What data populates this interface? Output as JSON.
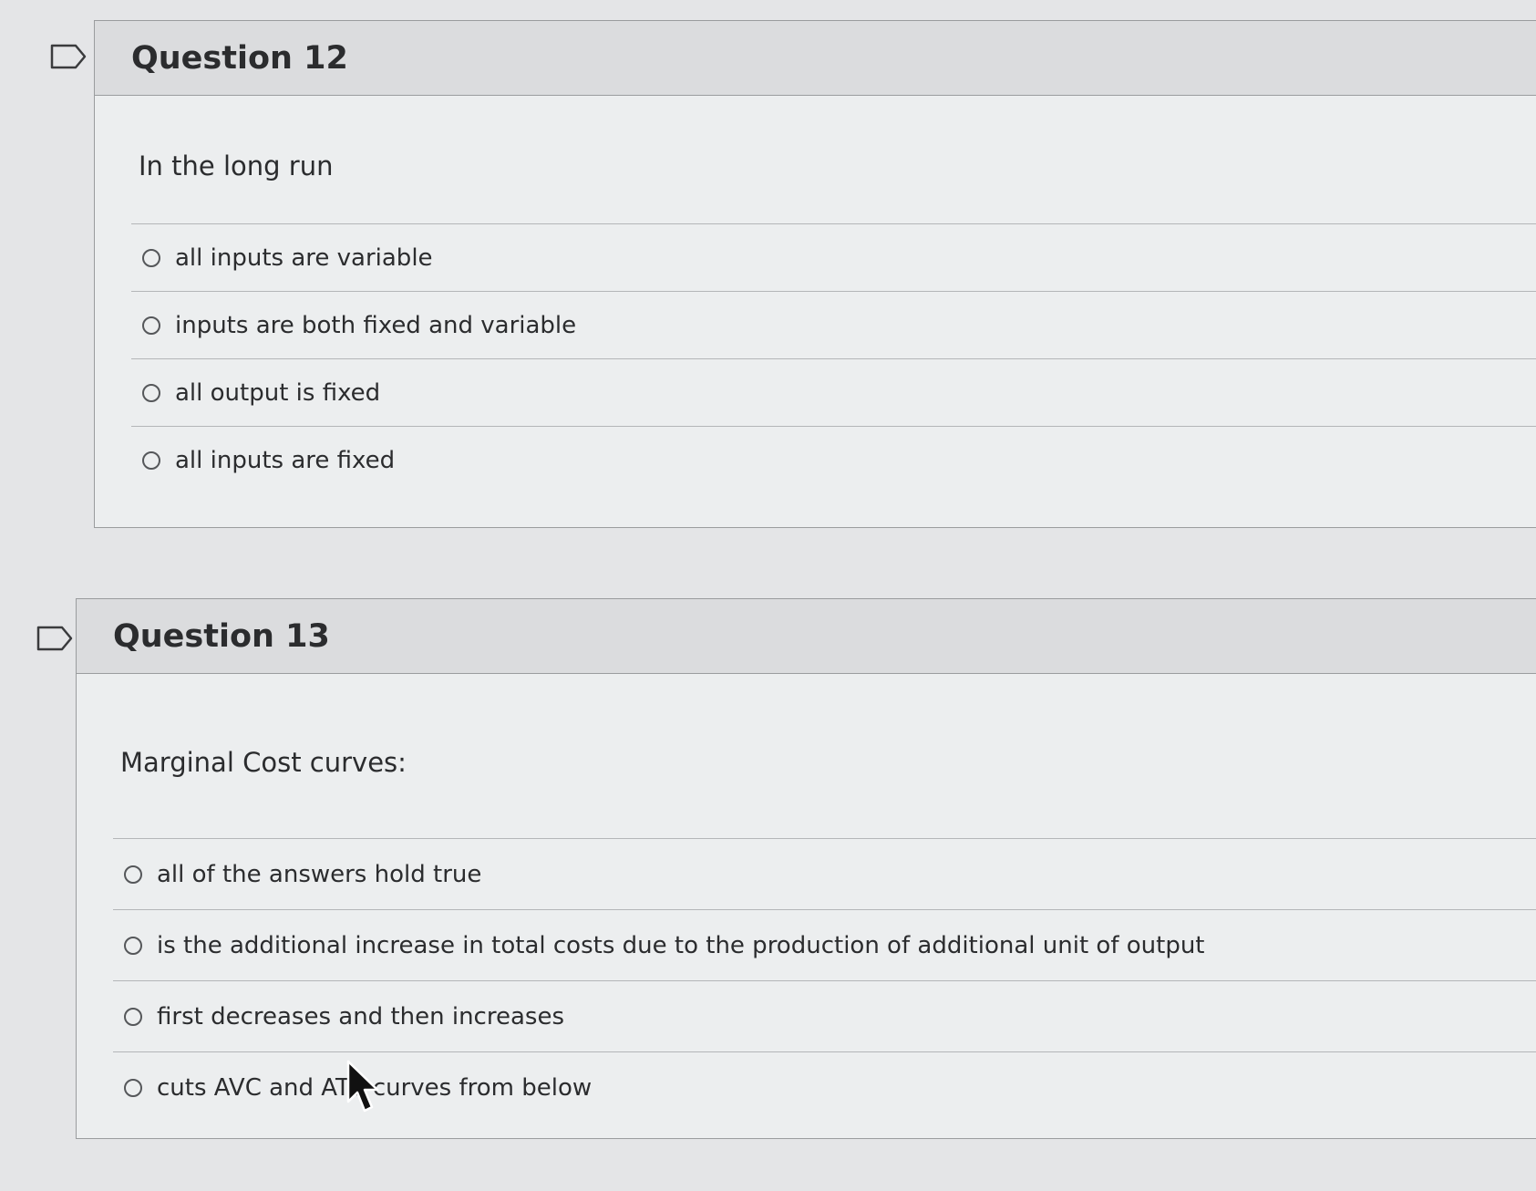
{
  "questions": [
    {
      "title": "Question 12",
      "prompt": "In the long run",
      "answers": [
        "all inputs are variable",
        "inputs are both fixed and variable",
        "all output is fixed",
        "all inputs are fixed"
      ]
    },
    {
      "title": "Question 13",
      "prompt": "Marginal Cost curves:",
      "answers": [
        "all of the answers hold true",
        "is the additional increase in total costs due to the production of additional unit of output",
        "first decreases and then increases",
        "cuts AVC and ATC curves from below"
      ]
    }
  ],
  "icons": {
    "flag": "flag-question-icon",
    "cursor": "mouse-pointer-icon"
  }
}
